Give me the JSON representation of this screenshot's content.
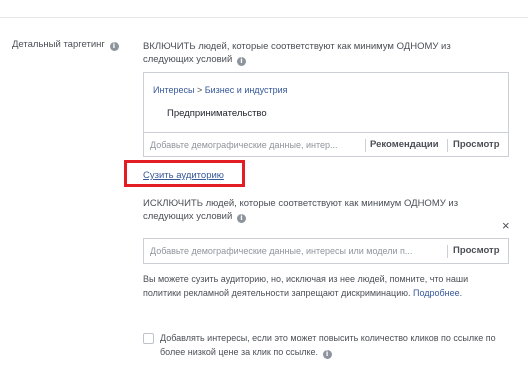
{
  "section": {
    "label": "Детальный таргетинг"
  },
  "include": {
    "heading": "ВКЛЮЧИТЬ людей, которые соответствуют как минимум ОДНОМУ из следующих условий",
    "breadcrumb": {
      "parent": "Интересы",
      "separator": ">",
      "child": "Бизнес и индустрия"
    },
    "selected_item": "Предпринимательство",
    "input_placeholder": "Добавьте демографические данные, интер...",
    "recommendations_label": "Рекомендации",
    "browse_label": "Просмотр"
  },
  "narrow_link": "Сузить аудиторию",
  "exclude": {
    "heading": "ИСКЛЮЧИТЬ людей, которые соответствуют как минимум ОДНОМУ из следующих условий",
    "close_glyph": "×",
    "input_placeholder": "Добавьте демографические данные, интересы или модели п...",
    "browse_label": "Просмотр"
  },
  "note": {
    "text": "Вы можете сузить аудиторию, но, исключая из нее людей, помните, что наши политики рекламной деятельности запрещают дискриминацию.",
    "more_link": "Подробнее."
  },
  "expand_interests": {
    "label": "Добавлять интересы, если это может повысить количество кликов по ссылке по более низкой цене за клик по ссылке.",
    "checked": false
  },
  "icons": {
    "info": "i"
  },
  "colors": {
    "link": "#365899",
    "highlight": "#e41c24",
    "border": "#ccd0d5"
  }
}
